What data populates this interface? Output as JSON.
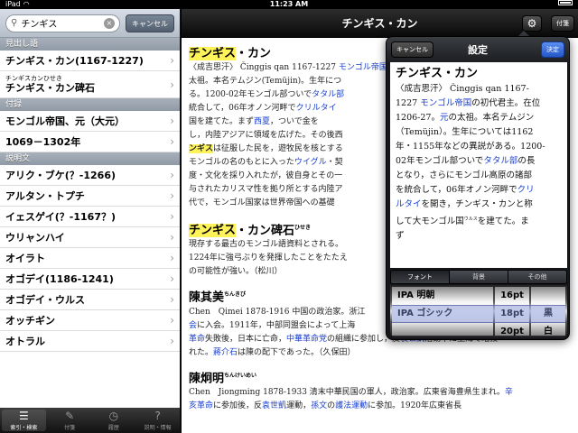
{
  "status": {
    "carrier": "iPad",
    "time": "11:23 AM"
  },
  "search": {
    "value": "チンギス",
    "cancel": "キャンセル"
  },
  "list": {
    "sections": [
      {
        "header": "見出し語",
        "rows": [
          {
            "label": "チンギス・カン(1167-1227)"
          },
          {
            "ruby": "チンギスカンひせき",
            "label": "チンギス・カン碑石"
          }
        ]
      },
      {
        "header": "付録",
        "rows": [
          {
            "label": "モンゴル帝国、元（大元）"
          },
          {
            "label": "1069－1302年"
          }
        ]
      },
      {
        "header": "説明文",
        "rows": [
          {
            "label": "アリク・ブケ(？-1266)"
          },
          {
            "label": "アルタン・トプチ"
          },
          {
            "label": "イェスゲイ(？-1167？)"
          },
          {
            "label": "ウリャンハイ"
          },
          {
            "label": "オイラト"
          },
          {
            "label": "オゴデイ(1186-1241)"
          },
          {
            "label": "オゴデイ・ウルス"
          },
          {
            "label": "オッチギン"
          },
          {
            "label": "オトラル"
          }
        ]
      }
    ]
  },
  "tabs": [
    {
      "label": "索引・検索",
      "icon": "list-icon"
    },
    {
      "label": "付箋",
      "icon": "pencil-icon"
    },
    {
      "label": "履歴",
      "icon": "clock-icon"
    },
    {
      "label": "説明・情報",
      "icon": "question-icon"
    }
  ],
  "nav": {
    "title": "チンギス・カン",
    "bookmark": "付箋"
  },
  "article": {
    "e1_title_hl": "チンギス",
    "e1_title_rest": "・カン",
    "e1_l1": "〈成吉思汗〉 Činggis qan 1167-1227 ",
    "e1_l1_link": "モンゴル帝国",
    "e1_l2": "太祖。本名テムジン(Temüjin)。生年につ",
    "e1_l3a": "る。1200-02年モンゴル部ついで",
    "e1_l3_link": "タタル部",
    "e1_l4a": "統合して，06年オノン河畔で",
    "e1_l4_link": "クリルタイ",
    "e1_l5a": "国",
    "e1_l5b": "を建てた。まず",
    "e1_l5_link": "西夏",
    "e1_l5c": "，ついで金を",
    "e1_l6": "し，内陸アジアに領域を広げた。その後西",
    "e1_l7_hl": "ンギス",
    "e1_l7": "は征服した民を，遊牧民を核とする",
    "e1_l8a": "モンゴルの名のもとに入った",
    "e1_l8_link": "ウイグル",
    "e1_l8b": "・契",
    "e1_l9": "度・文化を採り入れたが，彼自身とその一",
    "e1_l10": "与されたカリスマ性を拠り所とする内陸ア",
    "e1_l11": "代で，モンゴル国家は世界帝国への基礎",
    "e2_title_hl": "チンギス",
    "e2_title_rest": "・カン碑石",
    "e2_ruby": "ひせき",
    "e2_l1": "現存する最古のモンゴル語資料とされる。",
    "e2_l2": "1224年に強弓ぶりを発揮したことをたたえ",
    "e2_l3": "の可能性が強い。（松川）",
    "e3_title": "陳其美",
    "e3_ruby": "ちんきび",
    "e3_l1": "Chen　Qimei 1878-1916 中国の政治家。浙江",
    "e3_l2a": "会",
    "e3_l2b": "に入会。1911年，中部同盟会によって上海",
    "e3_l3_link1": "革命",
    "e3_l3a": "失敗後，日本に亡命，",
    "e3_l3_link2": "中華革命党",
    "e3_l3b": "の組織に参加し，反",
    "e3_l3_link3": "袁世凱",
    "e3_l3c": "活動中に上海で暗殺",
    "e3_l4a": "れた。",
    "e3_l4_link": "蔣介石",
    "e3_l4b": "は陳の配下であった。（久保田）",
    "e4_title": "陳炯明",
    "e4_ruby": "ちんけいめい",
    "e4_l1": "Chen　Jiongming 1878-1933 清末中華民国の軍人，政治家。広東省海豊県生まれ。",
    "e4_l1_link": "辛",
    "e4_l2a": "亥",
    "e4_l2_link1": "革命",
    "e4_l2b": "に参加後，反",
    "e4_l2_link2": "袁世凱",
    "e4_l2c": "運動，",
    "e4_l2_link3": "孫文",
    "e4_l2d": "の",
    "e4_l2_link4": "護法運動",
    "e4_l2e": "に参加。1920年広東省長"
  },
  "popover": {
    "title": "設定",
    "cancel": "キャンセル",
    "done": "決定",
    "preview": {
      "title": "チンギス・カン",
      "l1": "〈成吉思汗〉 Činggis qan 1167-",
      "l2a": "1227 ",
      "l2_link": "モンゴル帝国",
      "l2b": "の初代君主。在位",
      "l3a": "1206-27。",
      "l3_link": "元",
      "l3b": "の太祖。本名テムジン",
      "l4": "（Temüjin）。生年については1162",
      "l5": "年・1155年などの異説がある。1200-",
      "l6a": "02年モンゴル部ついで",
      "l6_link": "タタル部",
      "l6b": "の長",
      "l7": "となり，さらにモンゴル高原の諸部",
      "l8a": "を統合して，06年オノン河畔で",
      "l8_link": "クリ",
      "l9a": "ルタイ",
      "l9b": "を開き，チンギス・カンと称",
      "l10a": "して大モンゴル国",
      "l10_ruby": "ウルス",
      "l10b": "を建てた。ま",
      "l11": "ず"
    },
    "segments": [
      "フォント",
      "背景",
      "その他"
    ],
    "picker": {
      "fonts": [
        "IPA 明朝",
        "IPA ゴシック",
        ""
      ],
      "sizes": [
        "16pt",
        "18pt",
        "20pt"
      ],
      "colors": [
        "",
        "黒",
        "白"
      ],
      "selected": {
        "font": "IPA ゴシック",
        "size": "18pt",
        "color": "黒"
      }
    }
  },
  "colors": {
    "highlight": "#fff35a",
    "link": "#1a3fcf",
    "done": "#2f66d8"
  }
}
